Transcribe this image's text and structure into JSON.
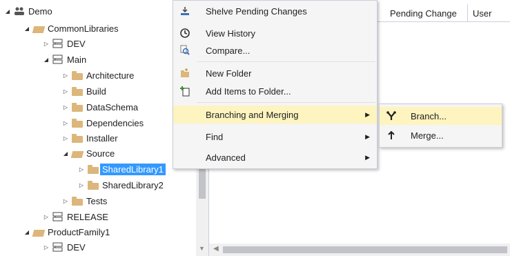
{
  "tree": {
    "rows": [
      {
        "label": "Demo",
        "icon": "team-project-icon",
        "expander": "expanded",
        "depth": 0
      },
      {
        "label": "CommonLibraries",
        "icon": "folder-open-icon",
        "expander": "expanded",
        "depth": 1
      },
      {
        "label": "DEV",
        "icon": "branch-icon",
        "expander": "collapsed",
        "depth": 2
      },
      {
        "label": "Main",
        "icon": "branch-icon",
        "expander": "expanded",
        "depth": 2
      },
      {
        "label": "Architecture",
        "icon": "folder-icon",
        "expander": "collapsed",
        "depth": 3
      },
      {
        "label": "Build",
        "icon": "folder-icon",
        "expander": "collapsed",
        "depth": 3
      },
      {
        "label": "DataSchema",
        "icon": "folder-icon",
        "expander": "collapsed",
        "depth": 3
      },
      {
        "label": "Dependencies",
        "icon": "folder-icon",
        "expander": "collapsed",
        "depth": 3
      },
      {
        "label": "Installer",
        "icon": "folder-icon",
        "expander": "collapsed",
        "depth": 3
      },
      {
        "label": "Source",
        "icon": "folder-open-icon",
        "expander": "expanded",
        "depth": 3
      },
      {
        "label": "SharedLibrary1",
        "icon": "folder-icon",
        "expander": "collapsed",
        "depth": 4,
        "selected": true
      },
      {
        "label": "SharedLibrary2",
        "icon": "folder-icon",
        "expander": "collapsed",
        "depth": 4
      },
      {
        "label": "Tests",
        "icon": "folder-icon",
        "expander": "collapsed",
        "depth": 3
      },
      {
        "label": "RELEASE",
        "icon": "branch-icon",
        "expander": "collapsed",
        "depth": 2
      },
      {
        "label": "ProductFamily1",
        "icon": "folder-open-icon",
        "expander": "expanded",
        "depth": 1
      },
      {
        "label": "DEV",
        "icon": "branch-icon",
        "expander": "collapsed",
        "depth": 2
      }
    ]
  },
  "details": {
    "columns": [
      "Pending Change",
      "User"
    ]
  },
  "context_menu": {
    "items": [
      {
        "label": "Shelve Pending Changes",
        "icon": "shelve-icon"
      },
      {
        "label": "View History",
        "icon": "history-icon"
      },
      {
        "label": "Compare...",
        "icon": "compare-icon"
      },
      {
        "label": "New Folder",
        "icon": "new-folder-icon"
      },
      {
        "label": "Add Items to Folder...",
        "icon": "add-items-icon"
      },
      {
        "label": "Branching and Merging",
        "submenu": true,
        "highlighted": true
      },
      {
        "label": "Find",
        "submenu": true
      },
      {
        "label": "Advanced",
        "submenu": true
      }
    ]
  },
  "submenu": {
    "items": [
      {
        "label": "Branch...",
        "icon": "branch-action-icon",
        "highlighted": true
      },
      {
        "label": "Merge...",
        "icon": "merge-icon"
      }
    ]
  },
  "colors": {
    "selection": "#3399ff",
    "menu_highlight": "#fdf4bf",
    "folder": "#dcb67a",
    "menu_bg": "#f5f5f5"
  }
}
